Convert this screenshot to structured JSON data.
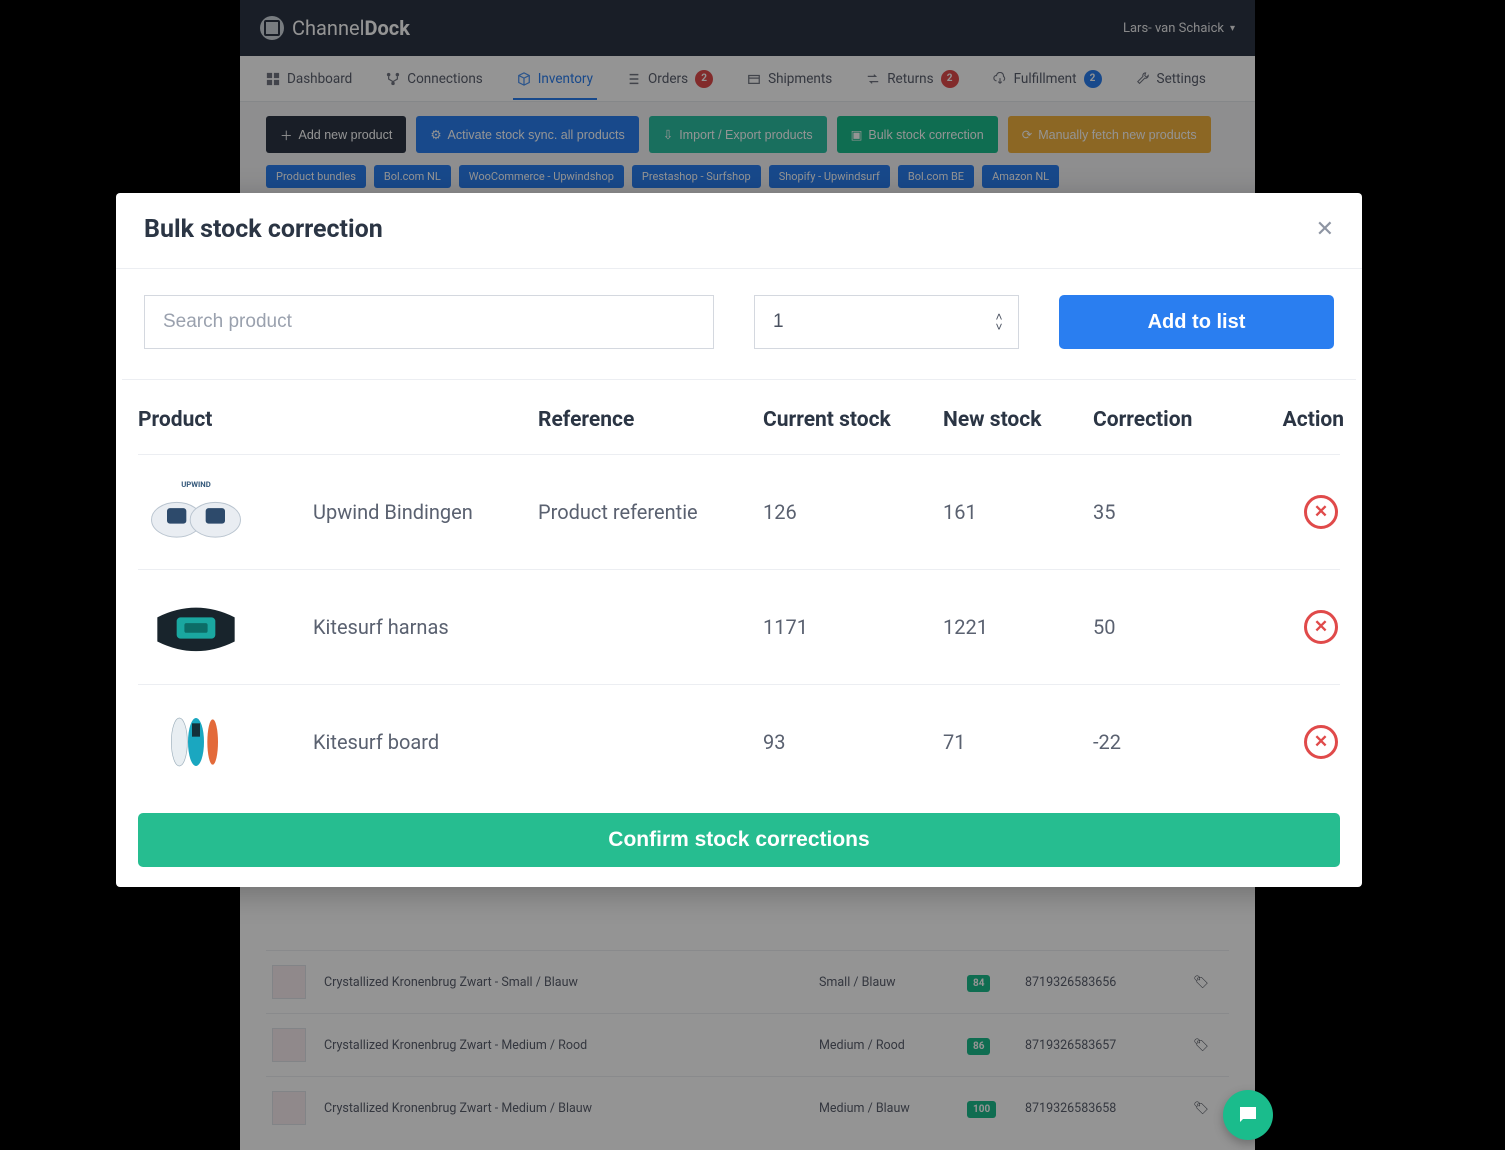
{
  "brand": {
    "name_a": "Channel",
    "name_b": "Dock"
  },
  "user": {
    "display": "Lars- van Schaick"
  },
  "nav": {
    "dashboard": "Dashboard",
    "connections": "Connections",
    "inventory": "Inventory",
    "orders": "Orders",
    "orders_badge": "2",
    "shipments": "Shipments",
    "returns": "Returns",
    "returns_badge": "2",
    "fulfillment": "Fulfillment",
    "fulfillment_badge": "2",
    "settings": "Settings"
  },
  "toolbar": {
    "add": "Add new product",
    "sync": "Activate stock sync. all products",
    "import": "Import / Export products",
    "bulk": "Bulk stock correction",
    "fetch": "Manually fetch new products"
  },
  "filters": {
    "bundles": "Product bundles",
    "bolnl": "Bol.com NL",
    "woo": "WooCommerce - Upwindshop",
    "presta": "Prestashop - Surfshop",
    "shopify": "Shopify - Upwindsurf",
    "bolbe": "Bol.com BE",
    "amznl": "Amazon NL"
  },
  "bgrows": [
    {
      "name": "Crystallized Kronenbrug Zwart - Small / Blauw",
      "variant": "Small / Blauw",
      "stock": "84",
      "ean": "8719326583656"
    },
    {
      "name": "Crystallized Kronenbrug Zwart - Medium / Rood",
      "variant": "Medium / Rood",
      "stock": "86",
      "ean": "8719326583657"
    },
    {
      "name": "Crystallized Kronenbrug Zwart - Medium / Blauw",
      "variant": "Medium / Blauw",
      "stock": "100",
      "ean": "8719326583658"
    }
  ],
  "modal": {
    "title": "Bulk stock correction",
    "search_placeholder": "Search product",
    "qty_value": "1",
    "add_to_list": "Add to list",
    "th_product": "Product",
    "th_reference": "Reference",
    "th_current": "Current stock",
    "th_new": "New stock",
    "th_corr": "Correction",
    "th_action": "Action",
    "confirm": "Confirm stock corrections",
    "rows": [
      {
        "product": "Upwind Bindingen",
        "reference": "Product referentie",
        "current": "126",
        "newstock": "161",
        "correction": "35"
      },
      {
        "product": "Kitesurf harnas",
        "reference": "",
        "current": "1171",
        "newstock": "1221",
        "correction": "50"
      },
      {
        "product": "Kitesurf board",
        "reference": "",
        "current": "93",
        "newstock": "71",
        "correction": "-22"
      }
    ]
  }
}
